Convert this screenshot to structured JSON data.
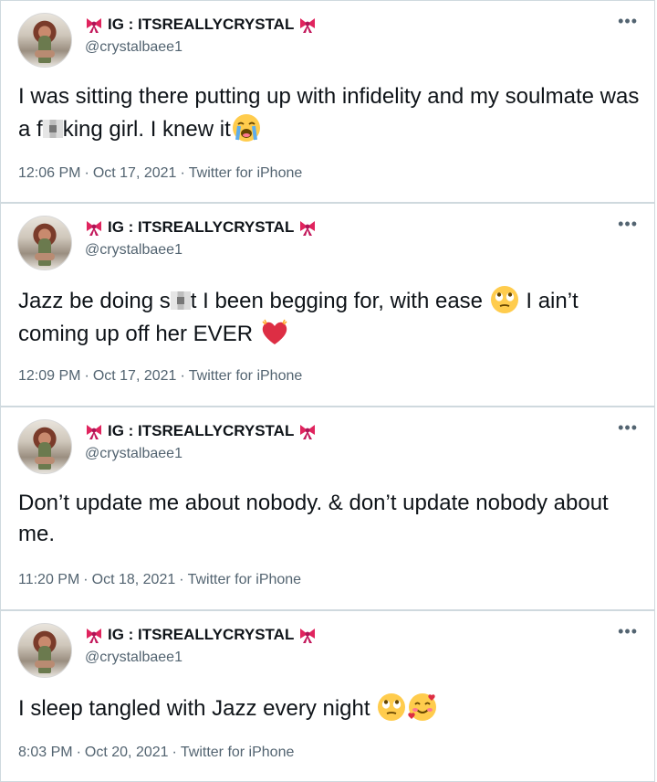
{
  "tweets": [
    {
      "display_name": "IG : ITSREALLYCRYSTAL",
      "handle": "@crystalbaee1",
      "text_parts": [
        "I was sitting there putting up with infidelity and my soulmate was a f",
        "king girl. I knew it"
      ],
      "time": "12:06 PM",
      "date": "Oct 17, 2021",
      "source": "Twitter for iPhone",
      "emojis": [
        "crying-face-emoji"
      ]
    },
    {
      "display_name": "IG : ITSREALLYCRYSTAL",
      "handle": "@crystalbaee1",
      "text_parts": [
        "Jazz be doing s",
        "t I been begging for, with ease ",
        " I ain’t coming up off her EVER "
      ],
      "time": "12:09 PM",
      "date": "Oct 17, 2021",
      "source": "Twitter for iPhone",
      "emojis": [
        "eye-roll-emoji",
        "heart-emoji"
      ]
    },
    {
      "display_name": "IG : ITSREALLYCRYSTAL",
      "handle": "@crystalbaee1",
      "text": "Don’t update me about nobody. & don’t update nobody about me.",
      "time": "11:20 PM",
      "date": "Oct 18, 2021",
      "source": "Twitter for iPhone"
    },
    {
      "display_name": "IG : ITSREALLYCRYSTAL",
      "handle": "@crystalbaee1",
      "text": "I sleep tangled with Jazz every night ",
      "time": "8:03 PM",
      "date": "Oct 20, 2021",
      "source": "Twitter for iPhone",
      "emojis": [
        "eye-roll-emoji",
        "smiling-face-with-hearts-emoji"
      ]
    }
  ],
  "more_icon": "•••",
  "separator": "·",
  "colors": {
    "text": "#0f1419",
    "secondary": "#536471",
    "border": "#cfd9de",
    "bow": "#e0245e"
  }
}
